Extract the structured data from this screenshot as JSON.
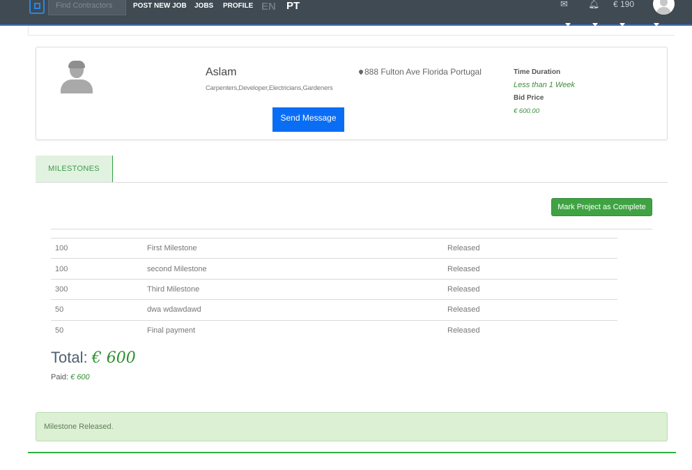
{
  "header": {
    "search_placeholder": "Find Contractors",
    "nav": [
      "POST NEW JOB",
      "JOBS",
      "PROFILE"
    ],
    "lang_en": "EN",
    "lang_pt": "PT",
    "balance": "€ 190"
  },
  "contractor": {
    "name": "Aslam",
    "skills": "Carpenters,Developer,Electricians,Gardeners",
    "send_message_label": "Send Message",
    "location": "888 Fulton Ave Florida Portugal",
    "time_duration_label": "Time Duration",
    "time_duration_value": "Less than 1 Week",
    "bid_price_label": "Bid Price",
    "bid_price_value": "€ 600.00"
  },
  "tabs": {
    "milestones": "MILESTONES"
  },
  "actions": {
    "mark_complete_label": "Mark Project as Complete"
  },
  "milestones": [
    {
      "amount": "100",
      "name": "First Milestone",
      "status": "Released"
    },
    {
      "amount": "100",
      "name": "second Milestone",
      "status": "Released"
    },
    {
      "amount": "300",
      "name": "Third Milestone",
      "status": "Released"
    },
    {
      "amount": "50",
      "name": "dwa wdawdawd",
      "status": "Released"
    },
    {
      "amount": "50",
      "name": "Final payment",
      "status": "Released"
    }
  ],
  "summary": {
    "total_label": "Total:",
    "total_value": "€ 600",
    "paid_label": "Paid:",
    "paid_value": "€ 600"
  },
  "alert": {
    "message": "Milestone Released."
  },
  "colors": {
    "primary_button": "#0a6ef5",
    "success": "#3fa344",
    "topbar": "#3f4a52"
  }
}
